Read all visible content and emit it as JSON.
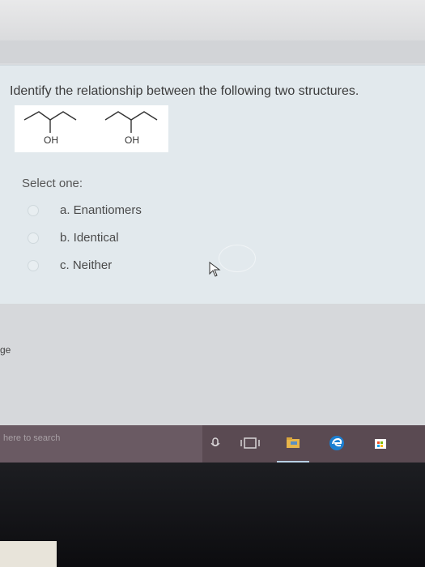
{
  "question": {
    "text": "Identify the relationship between the following two structures.",
    "structures": [
      {
        "label": "OH"
      },
      {
        "label": "OH"
      }
    ]
  },
  "answers": {
    "prompt": "Select one:",
    "options": [
      {
        "label": "a. Enantiomers",
        "selected": false
      },
      {
        "label": "b. Identical",
        "selected": false
      },
      {
        "label": "c. Neither",
        "selected": false
      }
    ]
  },
  "page_fragment": "ge",
  "taskbar": {
    "search_placeholder": "here to search",
    "icons": [
      "microphone-icon",
      "task-view-icon",
      "file-explorer-icon",
      "edge-icon",
      "store-icon"
    ]
  },
  "colors": {
    "card": "#e2e9ed",
    "taskbar": "#5a4a52",
    "edge_blue": "#1c7fd1"
  }
}
